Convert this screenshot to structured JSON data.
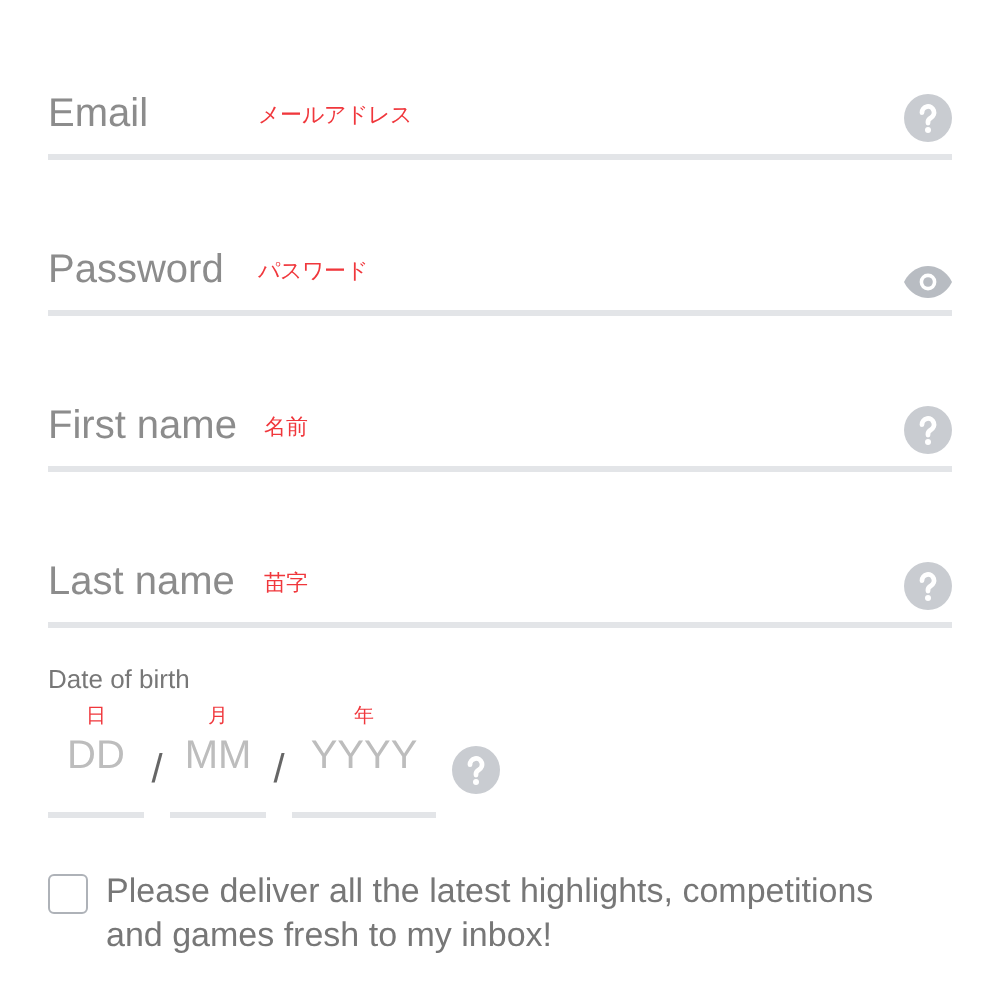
{
  "fields": [
    {
      "placeholder": "Email",
      "note": "メールアドレス",
      "kind": "help"
    },
    {
      "placeholder": "Password",
      "note": "パスワード",
      "kind": "reveal"
    },
    {
      "placeholder": "First name",
      "note": "名前",
      "kind": "help"
    },
    {
      "placeholder": "Last name",
      "note": "苗字",
      "kind": "help"
    }
  ],
  "date_of_birth": {
    "label": "Date of birth",
    "parts": [
      {
        "placeholder": "DD",
        "note": "日"
      },
      {
        "placeholder": "MM",
        "note": "月"
      },
      {
        "placeholder": "YYYY",
        "note": "年"
      }
    ],
    "separators": [
      "/",
      "/"
    ]
  },
  "newsletter": {
    "checked": false,
    "label": "Please deliver all the latest highlights, competitions and games fresh to my inbox!"
  }
}
